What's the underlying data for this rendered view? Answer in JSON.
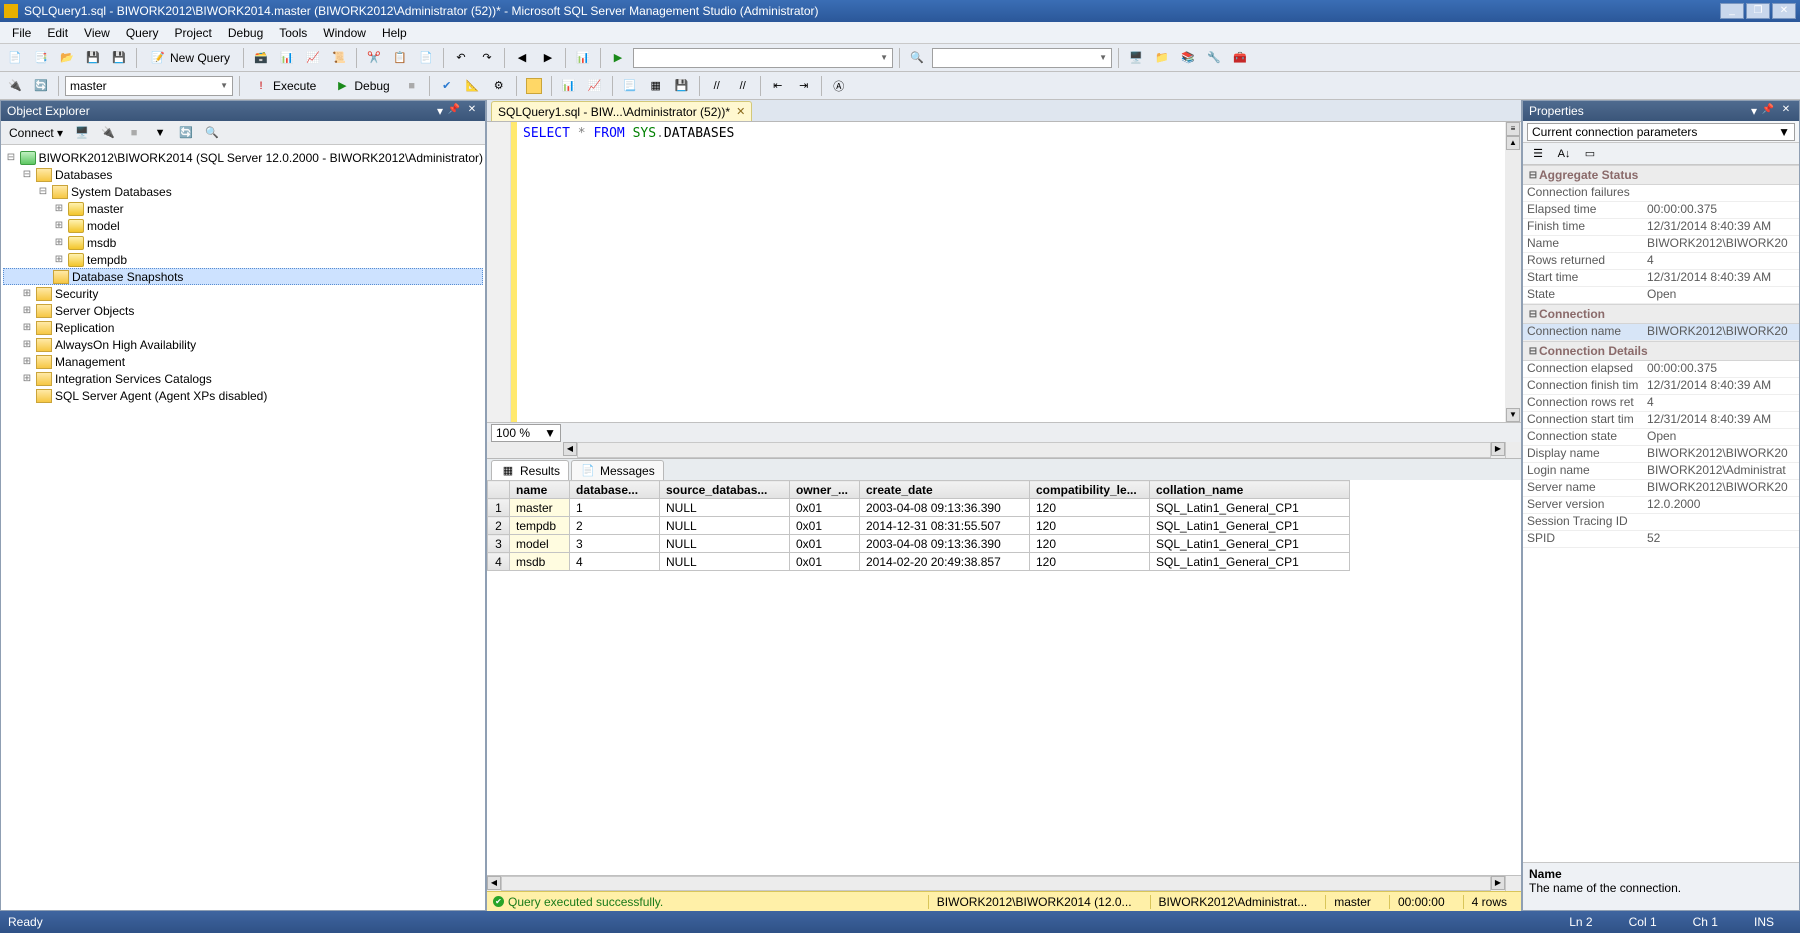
{
  "window": {
    "title": "SQLQuery1.sql - BIWORK2012\\BIWORK2014.master (BIWORK2012\\Administrator (52))* - Microsoft SQL Server Management Studio (Administrator)"
  },
  "menu": [
    "File",
    "Edit",
    "View",
    "Query",
    "Project",
    "Debug",
    "Tools",
    "Window",
    "Help"
  ],
  "toolbar1": {
    "new_query": "New Query",
    "combo1": ""
  },
  "toolbar2": {
    "db_combo": "master",
    "execute": "Execute",
    "debug": "Debug"
  },
  "object_explorer": {
    "title": "Object Explorer",
    "connect_label": "Connect",
    "root": "BIWORK2012\\BIWORK2014 (SQL Server 12.0.2000 - BIWORK2012\\Administrator)",
    "n_databases": "Databases",
    "n_sysdb": "System Databases",
    "sysdbs": [
      "master",
      "model",
      "msdb",
      "tempdb"
    ],
    "n_snapshots": "Database Snapshots",
    "others": [
      "Security",
      "Server Objects",
      "Replication",
      "AlwaysOn High Availability",
      "Management",
      "Integration Services Catalogs"
    ],
    "agent": "SQL Server Agent (Agent XPs disabled)"
  },
  "editor_tab": "SQLQuery1.sql - BIW...\\Administrator (52))*",
  "sql": {
    "kw1": "SELECT",
    "op": "*",
    "kw2": "FROM",
    "sys": "SYS",
    "dot": ".",
    "obj": "DATABASES"
  },
  "zoom": "100 %",
  "results": {
    "tab_results": "Results",
    "tab_messages": "Messages",
    "columns": [
      "name",
      "database...",
      "source_databas...",
      "owner_...",
      "create_date",
      "compatibility_le...",
      "collation_name"
    ],
    "rows": [
      {
        "n": "1",
        "name": "master",
        "dbid": "1",
        "src": "NULL",
        "owner": "0x01",
        "create": "2003-04-08 09:13:36.390",
        "compat": "120",
        "coll": "SQL_Latin1_General_CP1"
      },
      {
        "n": "2",
        "name": "tempdb",
        "dbid": "2",
        "src": "NULL",
        "owner": "0x01",
        "create": "2014-12-31 08:31:55.507",
        "compat": "120",
        "coll": "SQL_Latin1_General_CP1"
      },
      {
        "n": "3",
        "name": "model",
        "dbid": "3",
        "src": "NULL",
        "owner": "0x01",
        "create": "2003-04-08 09:13:36.390",
        "compat": "120",
        "coll": "SQL_Latin1_General_CP1"
      },
      {
        "n": "4",
        "name": "msdb",
        "dbid": "4",
        "src": "NULL",
        "owner": "0x01",
        "create": "2014-02-20 20:49:38.857",
        "compat": "120",
        "coll": "SQL_Latin1_General_CP1"
      }
    ]
  },
  "query_status": {
    "ok": "Query executed successfully.",
    "server": "BIWORK2012\\BIWORK2014 (12.0...",
    "login": "BIWORK2012\\Administrat...",
    "db": "master",
    "time": "00:00:00",
    "rows": "4 rows"
  },
  "properties": {
    "title": "Properties",
    "combo": "Current connection parameters",
    "cats": {
      "agg": "Aggregate Status",
      "conn": "Connection",
      "det": "Connection Details"
    },
    "rows": [
      {
        "cat": "agg",
        "k": "Connection failures",
        "v": ""
      },
      {
        "cat": "agg",
        "k": "Elapsed time",
        "v": "00:00:00.375"
      },
      {
        "cat": "agg",
        "k": "Finish time",
        "v": "12/31/2014 8:40:39 AM"
      },
      {
        "cat": "agg",
        "k": "Name",
        "v": "BIWORK2012\\BIWORK20"
      },
      {
        "cat": "agg",
        "k": "Rows returned",
        "v": "4"
      },
      {
        "cat": "agg",
        "k": "Start time",
        "v": "12/31/2014 8:40:39 AM"
      },
      {
        "cat": "agg",
        "k": "State",
        "v": "Open"
      },
      {
        "cat": "conn",
        "k": "Connection name",
        "v": "BIWORK2012\\BIWORK20",
        "sel": true
      },
      {
        "cat": "det",
        "k": "Connection elapsed",
        "v": "00:00:00.375"
      },
      {
        "cat": "det",
        "k": "Connection finish tim",
        "v": "12/31/2014 8:40:39 AM"
      },
      {
        "cat": "det",
        "k": "Connection rows ret",
        "v": "4"
      },
      {
        "cat": "det",
        "k": "Connection start tim",
        "v": "12/31/2014 8:40:39 AM"
      },
      {
        "cat": "det",
        "k": "Connection state",
        "v": "Open"
      },
      {
        "cat": "det",
        "k": "Display name",
        "v": "BIWORK2012\\BIWORK20"
      },
      {
        "cat": "det",
        "k": "Login name",
        "v": "BIWORK2012\\Administrat"
      },
      {
        "cat": "det",
        "k": "Server name",
        "v": "BIWORK2012\\BIWORK20"
      },
      {
        "cat": "det",
        "k": "Server version",
        "v": "12.0.2000"
      },
      {
        "cat": "det",
        "k": "Session Tracing ID",
        "v": ""
      },
      {
        "cat": "det",
        "k": "SPID",
        "v": "52"
      }
    ],
    "desc_title": "Name",
    "desc_text": "The name of the connection."
  },
  "statusbar": {
    "ready": "Ready",
    "ln": "Ln 2",
    "col": "Col 1",
    "ch": "Ch 1",
    "ins": "INS"
  }
}
